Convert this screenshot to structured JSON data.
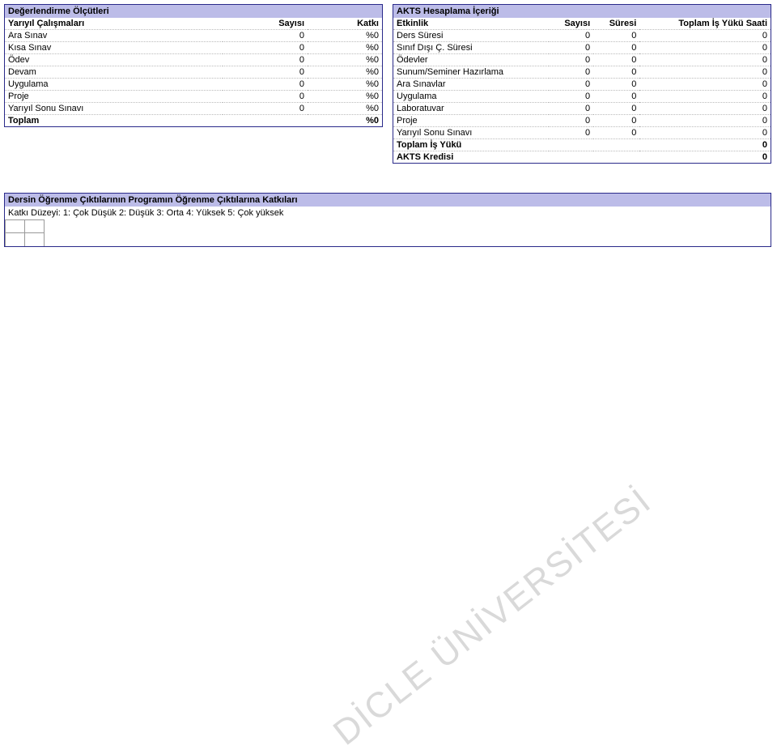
{
  "left": {
    "header": "Değerlendirme Ölçütleri",
    "columns": {
      "c1": "Yarıyıl Çalışmaları",
      "c2": "Sayısı",
      "c3": "Katkı"
    },
    "rows": [
      {
        "label": "Ara Sınav",
        "count": "0",
        "pct": "%0"
      },
      {
        "label": "Kısa Sınav",
        "count": "0",
        "pct": "%0"
      },
      {
        "label": "Ödev",
        "count": "0",
        "pct": "%0"
      },
      {
        "label": "Devam",
        "count": "0",
        "pct": "%0"
      },
      {
        "label": "Uygulama",
        "count": "0",
        "pct": "%0"
      },
      {
        "label": "Proje",
        "count": "0",
        "pct": "%0"
      },
      {
        "label": "Yarıyıl Sonu Sınavı",
        "count": "0",
        "pct": "%0"
      }
    ],
    "totalLabel": "Toplam",
    "totalPct": "%0"
  },
  "right": {
    "header": "AKTS Hesaplama İçeriği",
    "columns": {
      "c1": "Etkinlik",
      "c2": "Sayısı",
      "c3": "Süresi",
      "c4": "Toplam İş Yükü Saati"
    },
    "rows": [
      {
        "label": "Ders Süresi",
        "a": "0",
        "b": "0",
        "c": "0"
      },
      {
        "label": "Sınıf Dışı Ç. Süresi",
        "a": "0",
        "b": "0",
        "c": "0"
      },
      {
        "label": "Ödevler",
        "a": "0",
        "b": "0",
        "c": "0"
      },
      {
        "label": "Sunum/Seminer Hazırlama",
        "a": "0",
        "b": "0",
        "c": "0"
      },
      {
        "label": "Ara Sınavlar",
        "a": "0",
        "b": "0",
        "c": "0"
      },
      {
        "label": "Uygulama",
        "a": "0",
        "b": "0",
        "c": "0"
      },
      {
        "label": "Laboratuvar",
        "a": "0",
        "b": "0",
        "c": "0"
      },
      {
        "label": "Proje",
        "a": "0",
        "b": "0",
        "c": "0"
      },
      {
        "label": "Yarıyıl Sonu Sınavı",
        "a": "0",
        "b": "0",
        "c": "0"
      }
    ],
    "totalLoadLabel": "Toplam İş Yükü",
    "totalLoadValue": "0",
    "aktsLabel": "AKTS Kredisi",
    "aktsValue": "0"
  },
  "contrib": {
    "header": "Dersin Öğrenme Çıktılarının Programın Öğrenme Çıktılarına Katkıları",
    "scale": "Katkı Düzeyi: 1: Çok Düşük 2: Düşük 3: Orta 4: Yüksek 5: Çok yüksek"
  },
  "watermark": "DİCLE ÜNİVERSİTESİ"
}
